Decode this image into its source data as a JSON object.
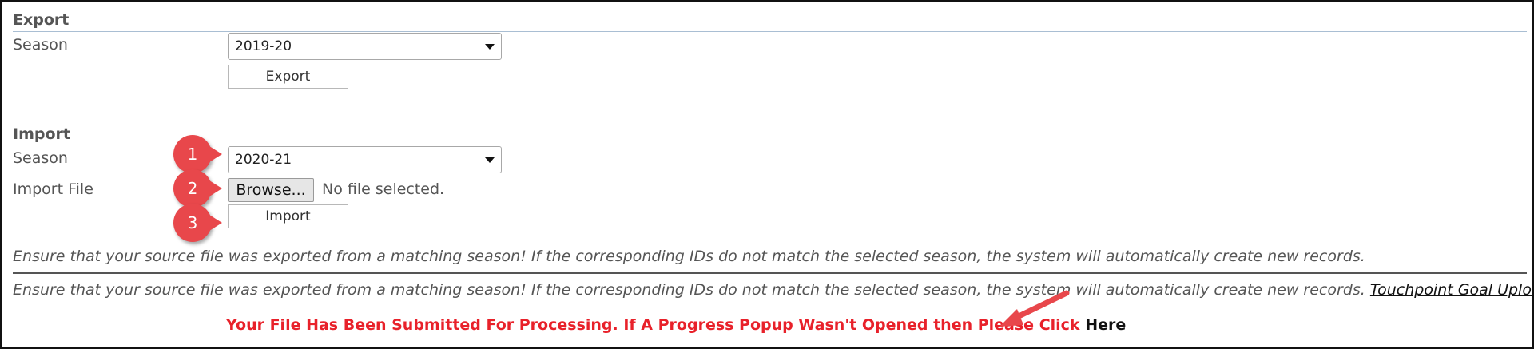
{
  "export": {
    "title": "Export",
    "season_label": "Season",
    "season_value": "2019-20",
    "button_label": "Export"
  },
  "import": {
    "title": "Import",
    "season_label": "Season",
    "season_value": "2020-21",
    "file_label": "Import File",
    "browse_label": "Browse...",
    "file_status": "No file selected.",
    "button_label": "Import"
  },
  "notes": {
    "warning_1": "Ensure that your source file was exported from a matching season! If the corresponding IDs do not match the selected season, the system will automatically create new records.",
    "warning_2": "Ensure that your source file was exported from a matching season! If the corresponding IDs do not match the selected season, the system will automatically create new records.",
    "uploader_link": "Touchpoint Goal Uploader"
  },
  "status": {
    "message": "Your File Has Been Submitted For Processing. If A Progress Popup Wasn't Opened then Please Click",
    "here_link": "Here"
  },
  "annotations": {
    "markers": [
      "1",
      "2",
      "3"
    ],
    "color": "#e8474b"
  },
  "colors": {
    "status_red": "#e8212a",
    "rule_blue": "#a9bed3"
  }
}
